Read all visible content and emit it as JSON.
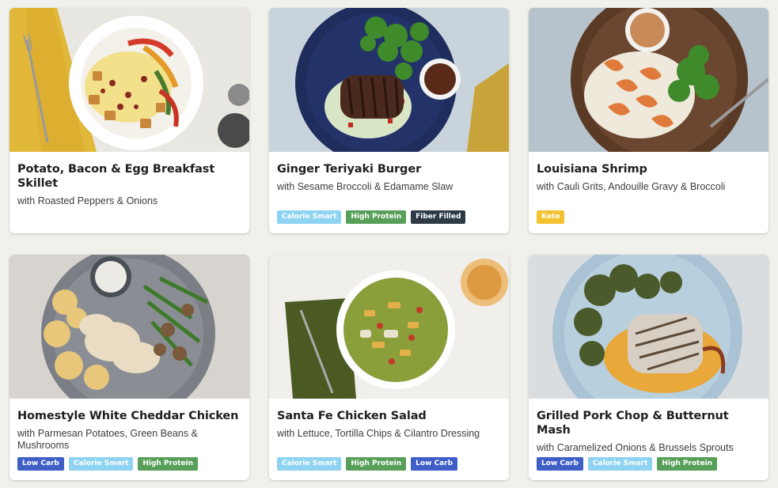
{
  "colors": {
    "page_background": "#f0f0ed",
    "card_background": "#ffffff",
    "calorie_smart": "#8fd3f2",
    "high_protein": "#58a05a",
    "fiber_filled": "#2e3a46",
    "keto": "#f2c230",
    "low_carb": "#3f5fc7"
  },
  "meals": [
    {
      "title": "Potato, Bacon & Egg Breakfast Skillet",
      "subtitle": "with Roasted Peppers & Onions",
      "image": "breakfast-skillet-photo",
      "tags": []
    },
    {
      "title": "Ginger Teriyaki Burger",
      "subtitle": "with Sesame Broccoli & Edamame Slaw",
      "image": "teriyaki-burger-photo",
      "tags": [
        "Calorie Smart",
        "High Protein",
        "Fiber Filled"
      ]
    },
    {
      "title": "Louisiana Shrimp",
      "subtitle": "with Cauli Grits, Andouille Gravy & Broccoli",
      "image": "louisiana-shrimp-photo",
      "tags": [
        "Keto"
      ]
    },
    {
      "title": "Homestyle White Cheddar Chicken",
      "subtitle": "with Parmesan Potatoes, Green Beans & Mushrooms",
      "image": "cheddar-chicken-photo",
      "tags": [
        "Low Carb",
        "Calorie Smart",
        "High Protein"
      ]
    },
    {
      "title": "Santa Fe Chicken Salad",
      "subtitle": "with Lettuce, Tortilla Chips & Cilantro Dressing",
      "image": "santa-fe-salad-photo",
      "tags": [
        "Calorie Smart",
        "High Protein",
        "Low Carb"
      ]
    },
    {
      "title": "Grilled Pork Chop & Butternut Mash",
      "subtitle": "with Caramelized Onions & Brussels Sprouts",
      "image": "pork-chop-photo",
      "tags": [
        "Low Carb",
        "Calorie Smart",
        "High Protein"
      ]
    }
  ]
}
